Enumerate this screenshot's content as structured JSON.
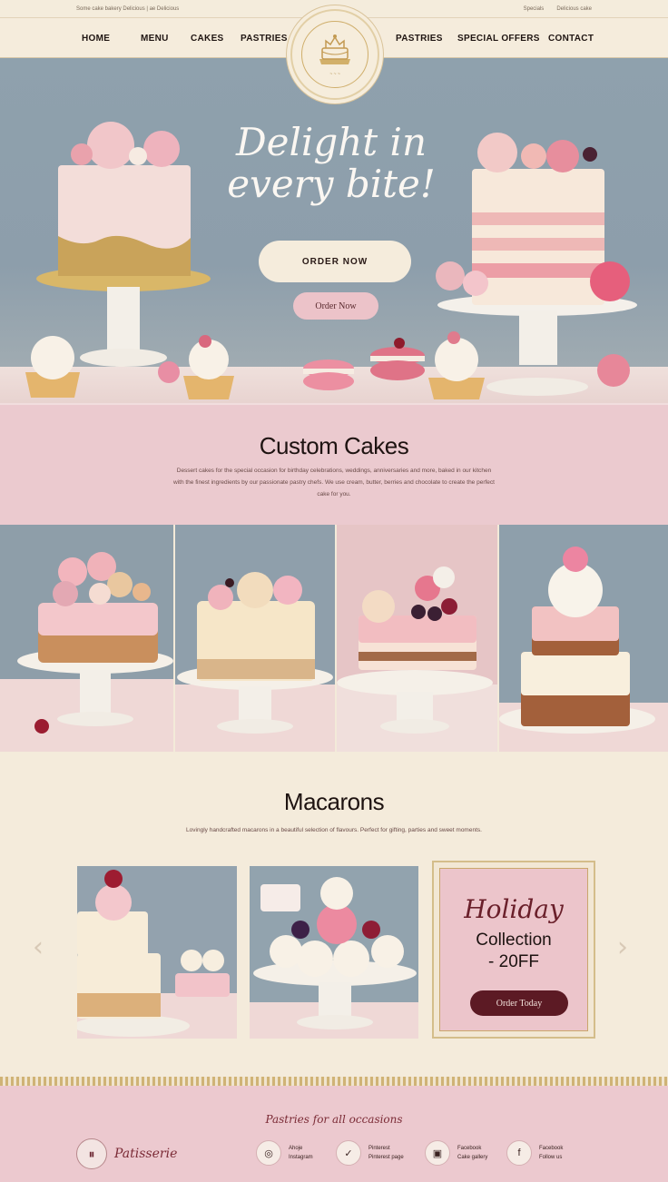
{
  "topbar": {
    "left_text": "Some cake bakery   Delicious   |   ae Delicious",
    "right_text": "Specials",
    "right_text2": "Delicious cake"
  },
  "nav": {
    "items": [
      "HOME",
      "MENU",
      "CAKES",
      "PASTRIES",
      "PASTRIES",
      "SPECIAL OFFERS",
      "CONTACT"
    ]
  },
  "hero": {
    "title": "Delight in every bite!",
    "order_primary": "ORDER NOW",
    "order_secondary": "Order Now"
  },
  "custom_cakes": {
    "title": "Custom Cakes",
    "body": "Dessert cakes for the special occasion for birthday celebrations, weddings, anniversaries and more, baked in our kitchen with the finest ingredients by our passionate pastry chefs. We use cream, butter, berries and chocolate to create the perfect cake for you."
  },
  "macarons": {
    "title": "Macarons",
    "body": "Lovingly handcrafted macarons in a beautiful selection of flavours. Perfect for gifting, parties and sweet moments."
  },
  "holiday": {
    "line1": "Holiday",
    "line2": "Collection",
    "line3": "- 20FF",
    "button": "Order Today"
  },
  "footer": {
    "tagline": "Pastries for all occasions",
    "brand": "Patisserie",
    "social": [
      {
        "icon": "instagram-icon",
        "glyph": "◎",
        "name": "Ahoje",
        "sub": "Instagram"
      },
      {
        "icon": "pinterest-icon",
        "glyph": "✓",
        "name": "Pinterest",
        "sub": "Pinterest page"
      },
      {
        "icon": "camera-icon",
        "glyph": "▣",
        "name": "Facebook",
        "sub": "Cake gallery"
      },
      {
        "icon": "facebook-icon",
        "glyph": "f",
        "name": "Facebook",
        "sub": "Follow us"
      }
    ]
  },
  "colors": {
    "hero_bg": "#8fa1ad",
    "pink": "#ebcacf",
    "cream": "#f4ebdb",
    "burgundy": "#5c1a24",
    "gold": "#c9a964"
  }
}
